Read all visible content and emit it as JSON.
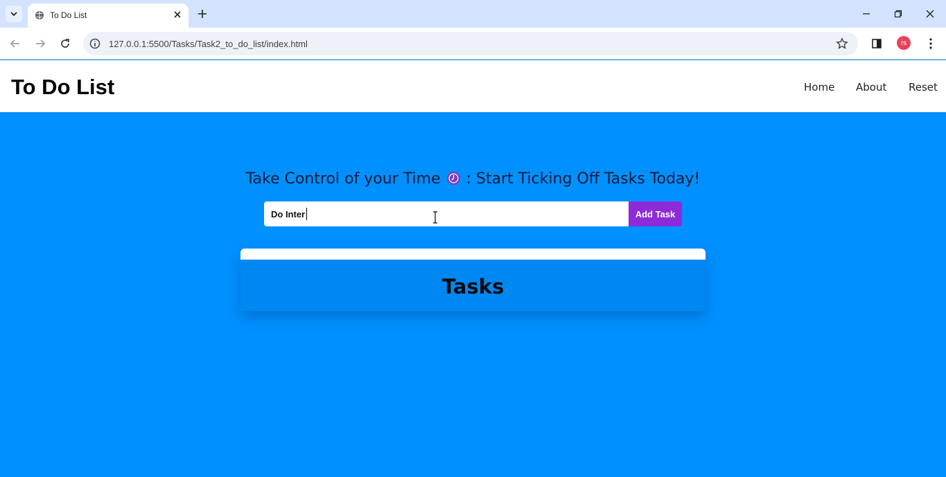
{
  "browser": {
    "tab_title": "To Do List",
    "url": "127.0.0.1:5500/Tasks/Task2_to_do_list/index.html",
    "profile_initials": "rs"
  },
  "header": {
    "title": "To Do List",
    "nav": [
      "Home",
      "About",
      "Reset"
    ]
  },
  "main": {
    "tagline_before": "Take Control of your Time",
    "tagline_after": ": Start Ticking Off Tasks Today!",
    "input_value": "Do Inter",
    "add_button_label": "Add Task",
    "tasks_heading": "Tasks"
  },
  "colors": {
    "page_background": "#0090ff",
    "add_button": "#8e2bd9",
    "tasks_card": "#0088f2"
  }
}
